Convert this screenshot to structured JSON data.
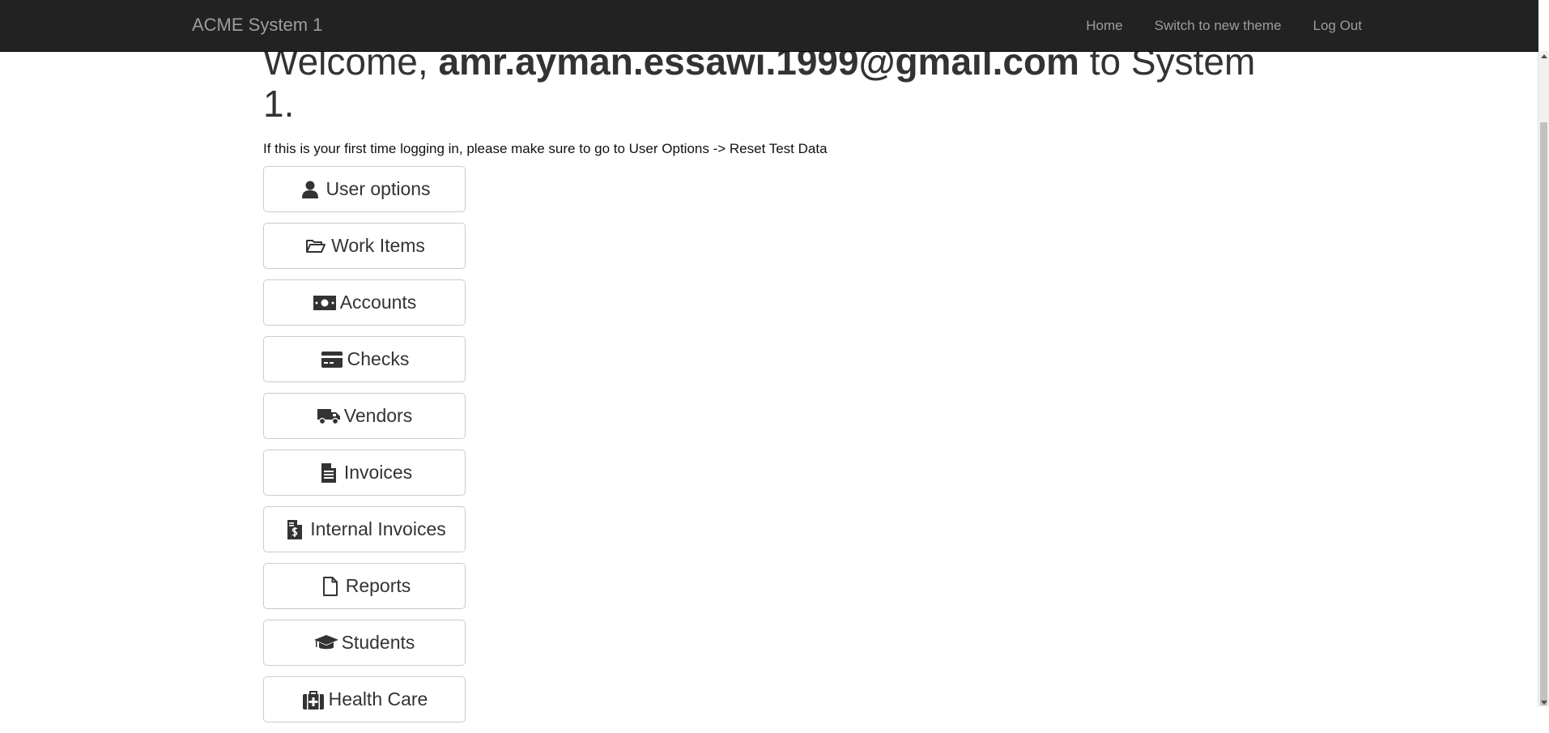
{
  "navbar": {
    "brand": "ACME System 1",
    "links": [
      "Home",
      "Switch to new theme",
      "Log Out"
    ]
  },
  "welcome": {
    "prefix": "Welcome, ",
    "email": "amr.ayman.essawi.1999@gmail.com",
    "suffix": " to System 1."
  },
  "notice": "If this is your first time logging in, please make sure to go to User Options -> Reset Test Data",
  "menu": [
    {
      "label": "User options",
      "icon": "user-icon"
    },
    {
      "label": "Work Items",
      "icon": "folder-open-icon"
    },
    {
      "label": "Accounts",
      "icon": "money-icon"
    },
    {
      "label": "Checks",
      "icon": "credit-card-icon"
    },
    {
      "label": "Vendors",
      "icon": "truck-icon"
    },
    {
      "label": "Invoices",
      "icon": "file-text-icon"
    },
    {
      "label": "Internal Invoices",
      "icon": "file-invoice-dollar-icon"
    },
    {
      "label": "Reports",
      "icon": "file-icon"
    },
    {
      "label": "Students",
      "icon": "graduation-cap-icon"
    },
    {
      "label": "Health Care",
      "icon": "medkit-icon"
    }
  ]
}
